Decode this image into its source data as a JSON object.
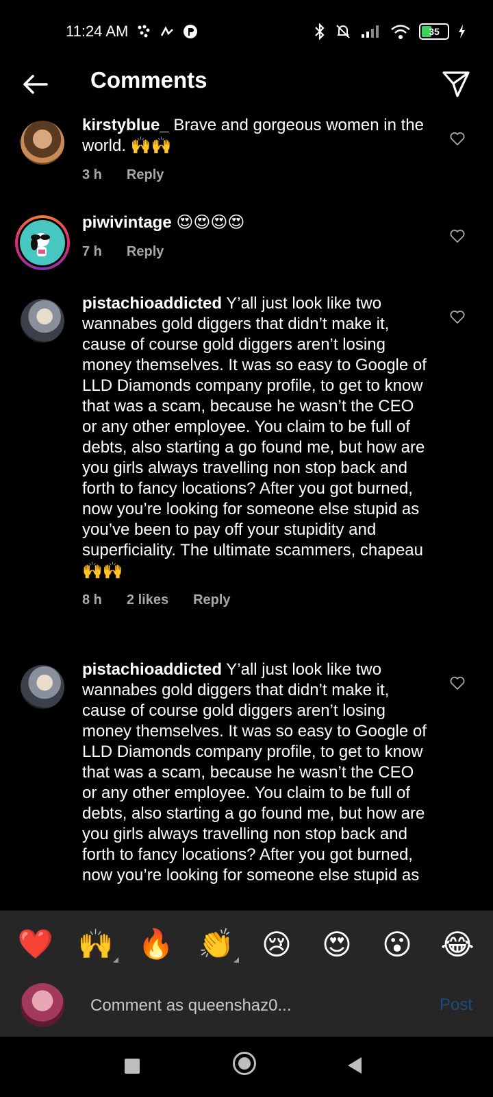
{
  "status": {
    "time": "11:24 AM",
    "battery": "35"
  },
  "header": {
    "title": "Comments"
  },
  "comments": [
    {
      "username": "kirstyblue_",
      "text": " Brave and gorgeous women in the world. 🙌🙌",
      "time": "3 h",
      "likes": "",
      "reply_label": "Reply"
    },
    {
      "username": "piwivintage",
      "text": " 😍😍😍😍",
      "time": "7 h",
      "likes": "",
      "reply_label": "Reply"
    },
    {
      "username": "pistachioaddicted",
      "text": " Y’all just look like two wannabes gold diggers that didn’t make it, cause of course gold diggers aren’t losing money themselves. It was so easy to Google of LLD Diamonds company profile, to get to know that was a scam, because he wasn’t the CEO or any other employee. You claim to be full of debts, also starting a go found me, but how are you girls always travelling non stop back and forth to fancy locations? After you got burned, now you’re looking for someone else stupid as you’ve been to pay off your stupidity and superficiality.  The ultimate scammers, chapeau 🙌🙌",
      "time": "8 h",
      "likes": "2 likes",
      "reply_label": "Reply"
    },
    {
      "username": "pistachioaddicted",
      "text": " Y’all just look like two wannabes gold diggers that didn’t make it, cause of course gold diggers aren’t losing money themselves. It was so easy to Google of LLD Diamonds company profile, to get to know that was a scam, because he wasn’t the CEO or any other employee. You claim to be full of debts, also starting a go found me, but how are you girls always travelling non stop back and forth to fancy locations? After you got burned, now you’re looking for someone else stupid as",
      "time": "",
      "likes": "",
      "reply_label": ""
    }
  ],
  "emoji_bar": [
    "❤️",
    "🙌",
    "🔥",
    "👏",
    "😢",
    "😍",
    "😮",
    "😂"
  ],
  "composer": {
    "placeholder": "Comment as queenshaz0...",
    "post_label": "Post"
  },
  "colors": {
    "background": "#000000",
    "panel": "#262626",
    "muted_text": "#a8a8a8",
    "post_disabled": "#1a4d7a"
  }
}
